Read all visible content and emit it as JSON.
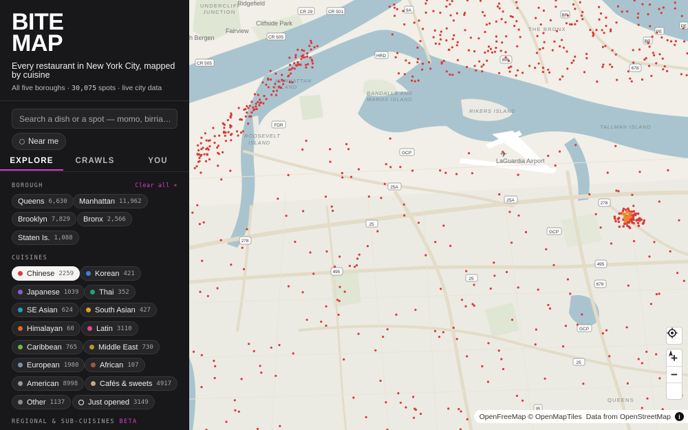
{
  "app": {
    "logo_line1": "BITE",
    "logo_line2": "MAP",
    "tagline": "Every restaurant in New York City, mapped by cuisine",
    "stats_prefix": "All five boroughs · ",
    "stats_count": "30,075",
    "stats_suffix": " spots · live city data"
  },
  "search": {
    "placeholder": "Search a dish or a spot — momo, birria…"
  },
  "near_me": {
    "label": "Near me",
    "icon": "location-ring-icon"
  },
  "tabs": [
    {
      "label": "EXPLORE",
      "active": true
    },
    {
      "label": "CRAWLS",
      "active": false
    },
    {
      "label": "YOU",
      "active": false
    }
  ],
  "borough": {
    "title": "BOROUGH",
    "clear_label": "Clear all ×",
    "items": [
      {
        "label": "Queens",
        "count": "6,630"
      },
      {
        "label": "Manhattan",
        "count": "11,962"
      },
      {
        "label": "Brooklyn",
        "count": "7,829"
      },
      {
        "label": "Bronx",
        "count": "2,566"
      },
      {
        "label": "Staten Is.",
        "count": "1,088"
      }
    ]
  },
  "cuisines": {
    "title": "CUISINES",
    "items": [
      {
        "label": "Chinese",
        "count": "2259",
        "color": "#d93a3a",
        "selected": true
      },
      {
        "label": "Korean",
        "count": "421",
        "color": "#3b7fdc"
      },
      {
        "label": "Japanese",
        "count": "1039",
        "color": "#8a5bd6"
      },
      {
        "label": "Thai",
        "count": "352",
        "color": "#20a37a"
      },
      {
        "label": "SE Asian",
        "count": "624",
        "color": "#20a0c0"
      },
      {
        "label": "South Asian",
        "count": "427",
        "color": "#e0a21f"
      },
      {
        "label": "Himalayan",
        "count": "60",
        "color": "#e06a1f"
      },
      {
        "label": "Latin",
        "count": "3110",
        "color": "#d94a8c"
      },
      {
        "label": "Caribbean",
        "count": "765",
        "color": "#6fb83a"
      },
      {
        "label": "Middle East",
        "count": "730",
        "color": "#b8962a"
      },
      {
        "label": "European",
        "count": "1980",
        "color": "#7f8fb0"
      },
      {
        "label": "African",
        "count": "107",
        "color": "#9c5a3a"
      },
      {
        "label": "American",
        "count": "8998",
        "color": "#9a9894"
      },
      {
        "label": "Cafés & sweets",
        "count": "4917",
        "color": "#c9a97f"
      },
      {
        "label": "Other",
        "count": "1137",
        "color": "#8e8c89"
      },
      {
        "label": "Just opened",
        "count": "3149",
        "color": "#f3f1ee",
        "ring": true
      }
    ]
  },
  "regional": {
    "title": "REGIONAL & SUB-CUISINES",
    "beta": "BETA"
  },
  "map": {
    "labels": {
      "undercliff": "UNDERCLIFF",
      "junction": "JUNCTION",
      "ridgefield": "Ridgefield",
      "cliffside": "Cliffside Park",
      "fairview": "Fairview",
      "bergen": "h Bergen",
      "manhattan_island": "MANHATTAN",
      "island": "ISLAND",
      "randalls1": "RANDALLS AND",
      "randalls2": "WARDS ISLAND",
      "rikers": "RIKERS ISLAND",
      "roosevelt": "ROOSEVELT",
      "roosevelt2": "ISLAND",
      "laguardia": "LaGuardia Airport",
      "tallman": "TALLMAN ISLAND",
      "bronx": "THE BRONX",
      "queens": "QUEENS"
    },
    "shields": [
      "CR 29",
      "CR 501",
      "CR 505",
      "CR 505",
      "FDR",
      "GCP",
      "GCP",
      "GCP",
      "25A",
      "25A",
      "25",
      "25",
      "25",
      "278",
      "278",
      "678",
      "495",
      "495",
      "895",
      "HRD",
      "BR",
      "BR",
      "PE",
      "PE",
      "IR",
      "9A",
      "678"
    ],
    "controls": {
      "locate_icon": "locate-crosshair-icon",
      "zoom_in": "+",
      "zoom_out": "−",
      "compass_icon": "compass-reset-icon"
    },
    "attribution": {
      "part1": "OpenFreeMap © OpenMapTiles",
      "part2": "Data from",
      "part3": "OpenStreetMap",
      "info_icon": "info-icon",
      "info_glyph": "i"
    },
    "dot_color": "#d93a3a",
    "highlight_dot_color": "#e88a2a"
  }
}
